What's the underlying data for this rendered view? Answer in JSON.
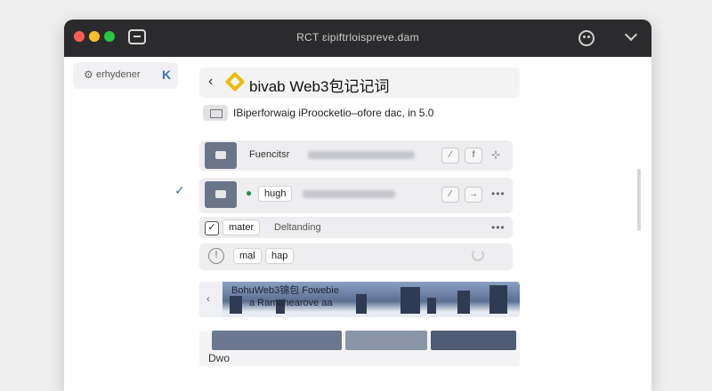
{
  "window": {
    "title": "RCT ɛipiftrloispreve.dam"
  },
  "sidebar": {
    "chip_label": "erhydener",
    "chip_icon": "gear-icon",
    "chip_action_icon": "k-icon"
  },
  "header": {
    "title": "bivab Web3包记记词",
    "subtitle": "IBiperforwaig iProocketio–ofore dac, in 5.0"
  },
  "rows": [
    {
      "label": "Fuencitsr",
      "action": "f"
    },
    {
      "tag": "hugh",
      "checked_marker": "✓"
    },
    {
      "tag": "mater",
      "checked": "✓",
      "label": "Deltanding"
    },
    {
      "tag_a": "mal",
      "tag_b": "hap"
    }
  ],
  "banner": {
    "line1": "BohuWeb3锦包 Fowebie",
    "line2": "a Ramahearove aa"
  },
  "bottom": {
    "label": "Dwo"
  },
  "colors": {
    "titlebar": "#2b2b2d",
    "accent": "#3f74c6",
    "binance": "#f0b90b"
  }
}
